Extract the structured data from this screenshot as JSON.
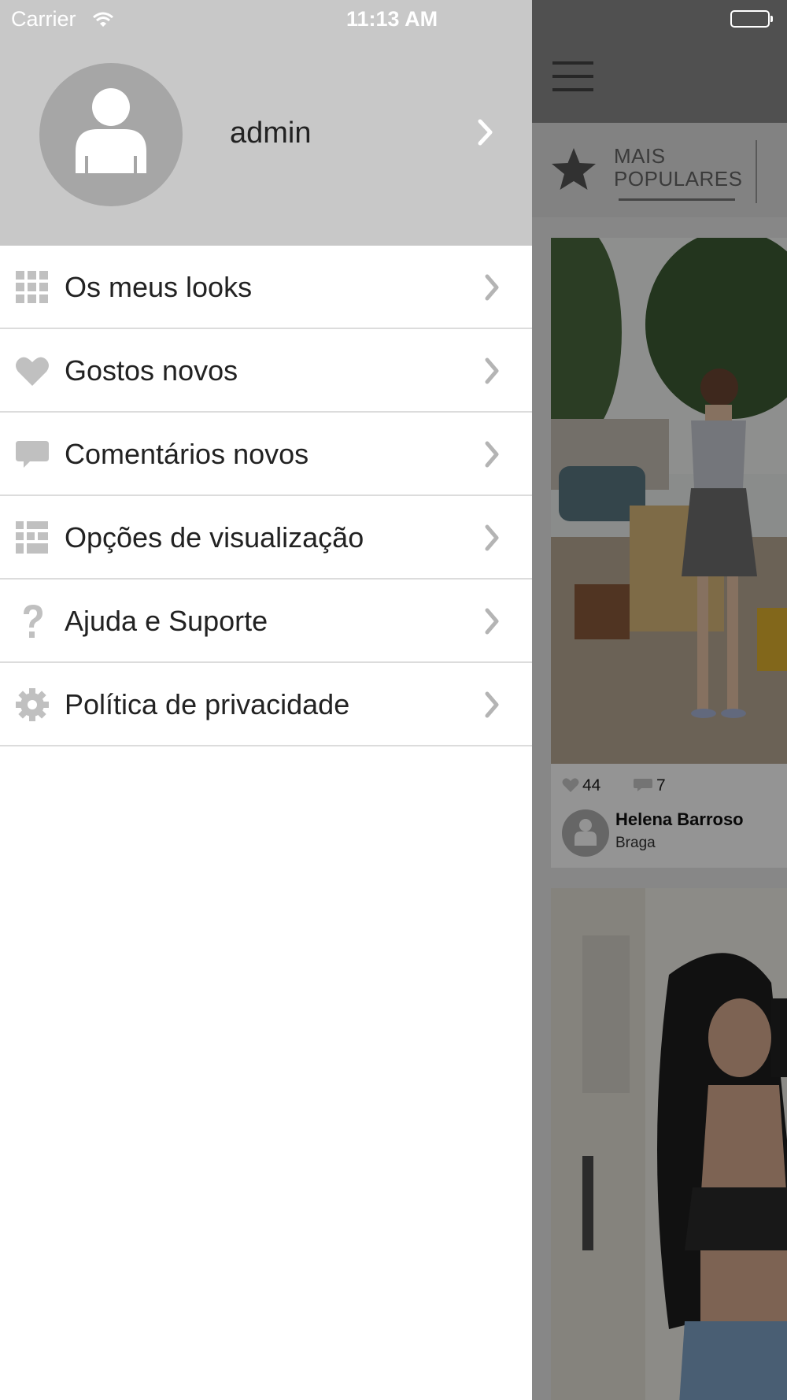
{
  "status_bar": {
    "carrier": "Carrier",
    "time": "11:13 AM",
    "battery_level": 1.0
  },
  "drawer": {
    "profile": {
      "username": "admin",
      "avatar_icon": "person-icon"
    },
    "menu_items": [
      {
        "label": "Os meus looks",
        "icon": "grid-icon"
      },
      {
        "label": "Gostos novos",
        "icon": "heart-icon"
      },
      {
        "label": "Comentários novos",
        "icon": "speech-bubble-icon"
      },
      {
        "label": "Opções de visualização",
        "icon": "layout-grid-icon"
      },
      {
        "label": "Ajuda e Suporte",
        "icon": "question-mark-icon"
      },
      {
        "label": "Política de privacidade",
        "icon": "gear-icon"
      }
    ]
  },
  "main": {
    "tab": {
      "label_line1": "MAIS",
      "label_line2": "POPULARES",
      "icon": "star-icon"
    },
    "posts": [
      {
        "likes": "44",
        "comments": "7",
        "author": "Helena Barroso",
        "city": "Braga"
      }
    ]
  },
  "colors": {
    "drawer_header_bg": "#c8c8c8",
    "avatar_bg": "#a6a6a6",
    "icon_gray": "#c0c0c0",
    "chevron_gray": "#b4b4b4",
    "divider": "#dcdcdc",
    "overlay": "rgba(0,0,0,0.42)"
  }
}
